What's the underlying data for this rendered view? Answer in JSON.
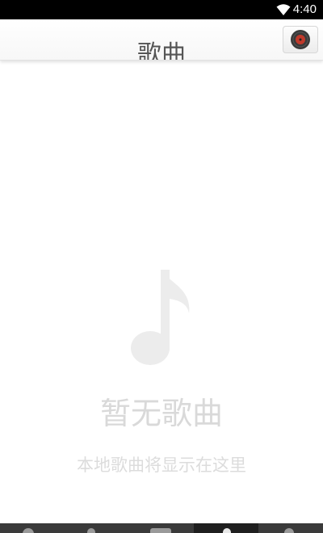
{
  "status_bar": {
    "time": "4:40",
    "icons": [
      "wifi-icon"
    ]
  },
  "header": {
    "title": "歌曲",
    "player_button_icon": "vinyl-record-icon",
    "accent_color": "#c0392b"
  },
  "empty_state": {
    "icon": "music-note-icon",
    "title": "暂无歌曲",
    "subtitle": "本地歌曲将显示在这里"
  },
  "bottom_nav": {
    "tabs": [
      {
        "icon": "tab-icon-1",
        "active": false
      },
      {
        "icon": "tab-icon-2",
        "active": false
      },
      {
        "icon": "tab-icon-3",
        "active": false
      },
      {
        "icon": "tab-icon-4",
        "active": true
      },
      {
        "icon": "tab-icon-5",
        "active": false
      }
    ]
  }
}
